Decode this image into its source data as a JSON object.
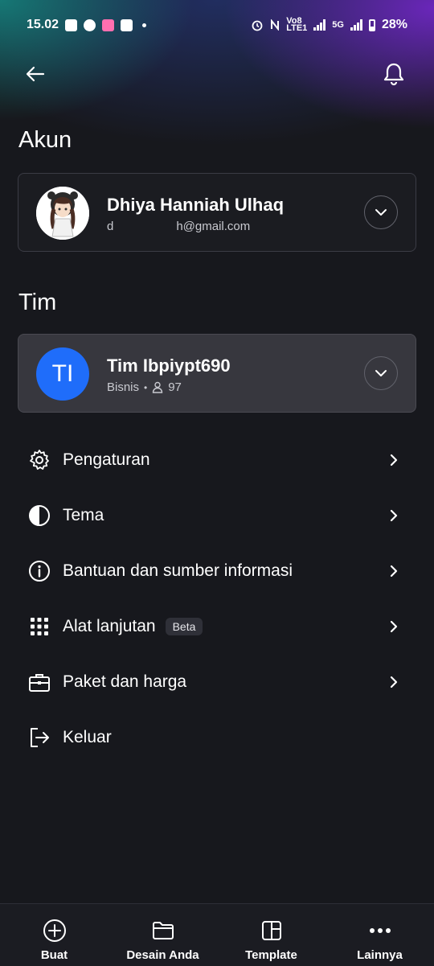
{
  "status_bar": {
    "time": "15.02",
    "network_small": "Vo8\nLTE1",
    "network_5g": "5G",
    "battery": "28%"
  },
  "header": {
    "back_icon": "arrow-left-icon",
    "notification_icon": "bell-icon"
  },
  "account": {
    "section_title": "Akun",
    "name": "Dhiya Hanniah Ulhaq",
    "email_prefix": "d",
    "email_suffix": "h@gmail.com",
    "expand_icon": "chevron-down-icon"
  },
  "team": {
    "section_title": "Tim",
    "initials": "TI",
    "name": "Tim Ibpiypt690",
    "plan": "Bisnis",
    "members": "97",
    "avatar_color": "#1f6dfa",
    "expand_icon": "chevron-down-icon"
  },
  "menu": {
    "items": [
      {
        "label": "Pengaturan",
        "icon": "gear-icon"
      },
      {
        "label": "Tema",
        "icon": "contrast-icon"
      },
      {
        "label": "Bantuan dan sumber informasi",
        "icon": "info-icon"
      },
      {
        "label": "Alat lanjutan",
        "icon": "grid-icon",
        "badge": "Beta"
      },
      {
        "label": "Paket dan harga",
        "icon": "briefcase-icon"
      },
      {
        "label": "Keluar",
        "icon": "logout-icon"
      }
    ]
  },
  "bottom_nav": {
    "items": [
      {
        "label": "Buat",
        "icon": "plus-circle-icon"
      },
      {
        "label": "Desain Anda",
        "icon": "folder-icon"
      },
      {
        "label": "Template",
        "icon": "template-icon"
      },
      {
        "label": "Lainnya",
        "icon": "more-icon"
      }
    ]
  }
}
